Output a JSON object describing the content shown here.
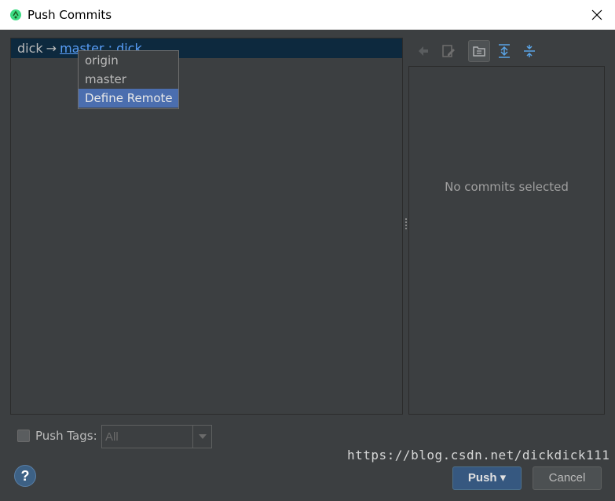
{
  "window": {
    "title": "Push Commits",
    "close_glyph": "✕"
  },
  "repo": {
    "local_branch": "dick",
    "arrow": "→",
    "remote_branch": "master : dick"
  },
  "remote_popup": {
    "items": [
      "origin",
      "master",
      "Define Remote"
    ],
    "selected_index": 2
  },
  "details": {
    "empty_text": "No commits selected"
  },
  "push_tags": {
    "label": "Push Tags:",
    "checked": false,
    "selected_value": "All"
  },
  "buttons": {
    "push_label": "Push ▾",
    "cancel_label": "Cancel",
    "help_label": "?"
  },
  "watermark": "https://blog.csdn.net/dickdick111",
  "colors": {
    "accent": "#4b6eaf",
    "selected_row": "#0d293e",
    "link": "#589df6",
    "background": "#3c3f41"
  }
}
